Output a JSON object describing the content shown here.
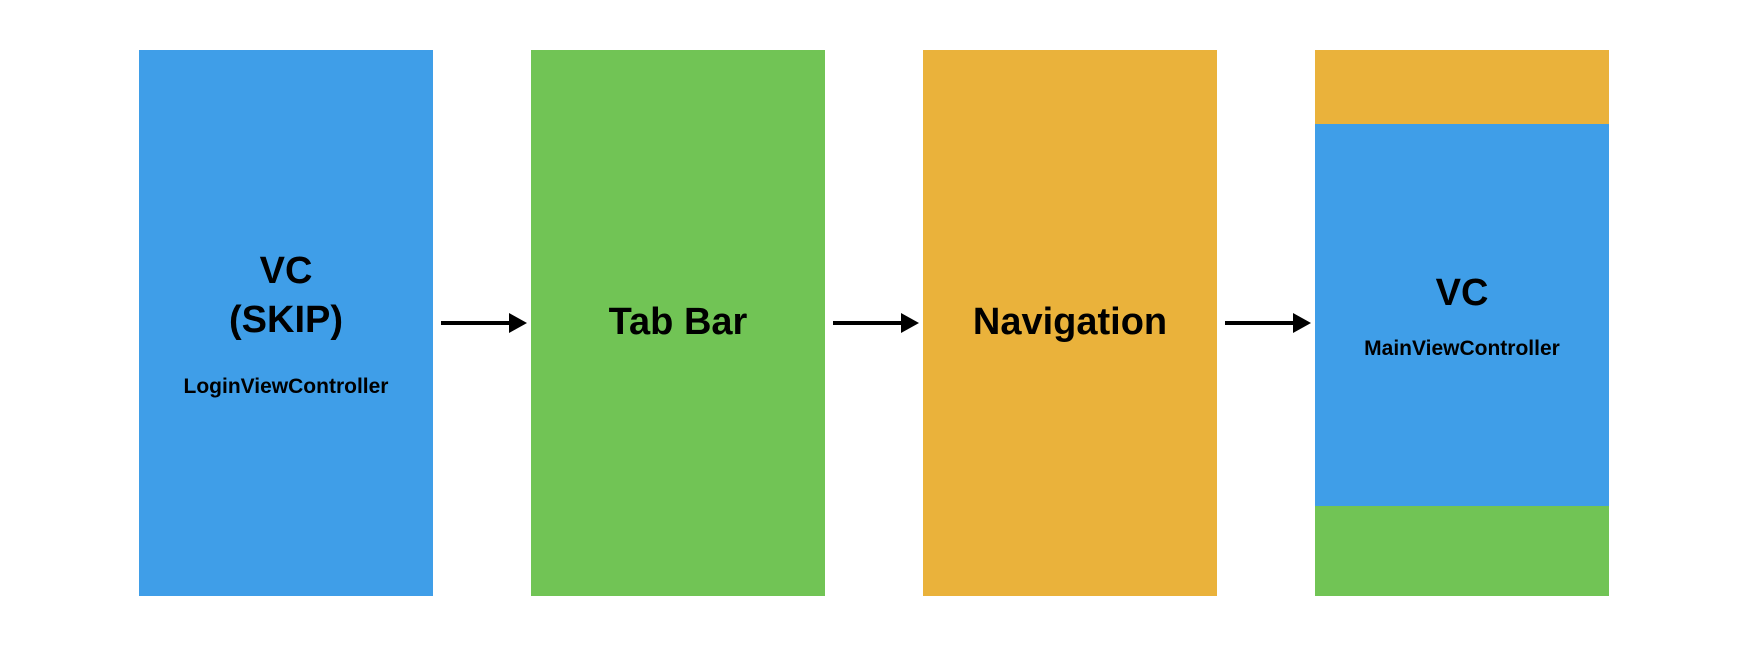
{
  "blocks": [
    {
      "title": "VC\n(SKIP)",
      "subtitle": "LoginViewController",
      "color": "blue"
    },
    {
      "title": "Tab Bar",
      "subtitle": "",
      "color": "green"
    },
    {
      "title": "Navigation",
      "subtitle": "",
      "color": "orange"
    },
    {
      "title": "VC",
      "subtitle": "MainViewController",
      "color": "layered",
      "layers": [
        "orange",
        "blue",
        "green"
      ]
    }
  ],
  "colors": {
    "blue": "#3f9ee8",
    "green": "#71c455",
    "orange": "#eab23b"
  }
}
